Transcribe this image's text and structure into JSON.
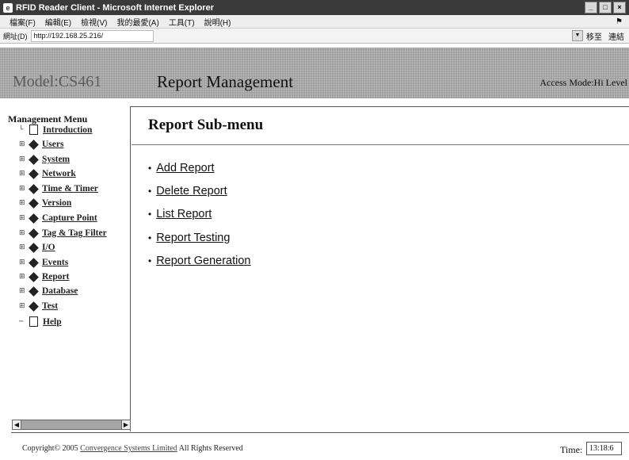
{
  "window": {
    "title": "RFID Reader Client - Microsoft Internet Explorer",
    "menu": [
      "檔案(F)",
      "編輯(E)",
      "檢視(V)",
      "我的最愛(A)",
      "工具(T)",
      "說明(H)"
    ],
    "address_label": "網址(D)",
    "address_value": "http://192.168.25.216/",
    "go_label": "移至",
    "links_label": "連結"
  },
  "header": {
    "model": "Model:CS461",
    "title": "Report Management",
    "access_mode": "Access Mode:Hi Level"
  },
  "sidebar": {
    "title": "Management Menu",
    "items": [
      {
        "label": "Introduction",
        "icon": "doc-icon"
      },
      {
        "label": "Users",
        "icon": "folder-icon"
      },
      {
        "label": "System",
        "icon": "folder-icon"
      },
      {
        "label": "Network",
        "icon": "folder-icon"
      },
      {
        "label": "Time & Timer",
        "icon": "folder-icon"
      },
      {
        "label": "Version",
        "icon": "folder-icon"
      },
      {
        "label": "Capture Point",
        "icon": "folder-icon"
      },
      {
        "label": "Tag & Tag Filter",
        "icon": "folder-icon"
      },
      {
        "label": "I/O",
        "icon": "folder-icon"
      },
      {
        "label": "Events",
        "icon": "folder-icon"
      },
      {
        "label": "Report",
        "icon": "folder-icon"
      },
      {
        "label": "Database",
        "icon": "folder-icon"
      },
      {
        "label": "Test",
        "icon": "folder-icon"
      },
      {
        "label": "Help",
        "icon": "doc-icon"
      }
    ]
  },
  "main": {
    "subtitle": "Report  Sub-menu",
    "links": [
      "Add  Report",
      "Delete  Report",
      "List  Report",
      "Report  Testing",
      "Report  Generation"
    ]
  },
  "footer": {
    "copyright_prefix": "Copyright© 2005",
    "company": "Convergence Systems Limited",
    "copyright_suffix": "All Rights Reserved",
    "time_label": "Time:",
    "time_value": "13:18:6"
  }
}
